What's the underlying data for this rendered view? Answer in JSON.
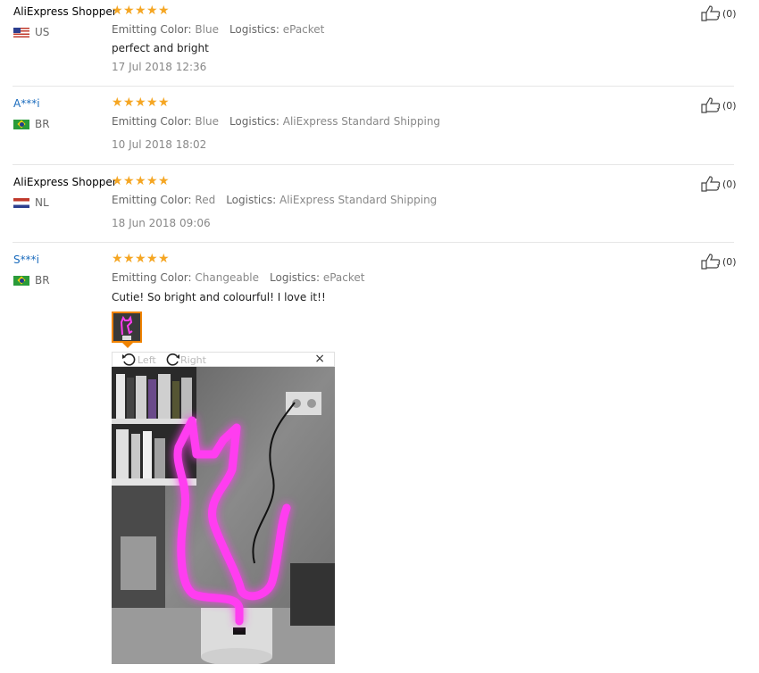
{
  "reviews": [
    {
      "user": "AliExpress Shopper",
      "country": "US",
      "stars": 5,
      "color_label": "Emitting Color:",
      "color_value": "Blue",
      "logistics_label": "Logistics:",
      "logistics_value": "ePacket",
      "text": "perfect and bright",
      "date": "17 Jul 2018 12:36",
      "likes": "(0)"
    },
    {
      "user": "A***i",
      "country": "BR",
      "stars": 5,
      "color_label": "Emitting Color:",
      "color_value": "Blue",
      "logistics_label": "Logistics:",
      "logistics_value": "AliExpress Standard Shipping",
      "date": "10 Jul 2018 18:02",
      "likes": "(0)"
    },
    {
      "user": "AliExpress Shopper",
      "country": "NL",
      "stars": 5,
      "color_label": "Emitting Color:",
      "color_value": "Red",
      "logistics_label": "Logistics:",
      "logistics_value": "AliExpress Standard Shipping",
      "date": "18 Jun 2018 09:06",
      "likes": "(0)"
    },
    {
      "user": "S***i",
      "country": "BR",
      "stars": 5,
      "color_label": "Emitting Color:",
      "color_value": "Changeable",
      "logistics_label": "Logistics:",
      "logistics_value": "ePacket",
      "text": "Cutie! So bright and colourful! I love it!!",
      "likes": "(0)"
    }
  ],
  "viewer": {
    "rotate_left": "Left",
    "rotate_right": "Right",
    "close": "×"
  },
  "colors": {
    "star": "#f5a623",
    "anon_user": "#1a6bbd",
    "thumb_border": "#f08300",
    "neon": "#ff3df0"
  },
  "icons": {
    "like": "thumbs-up-icon",
    "rotate_left": "rotate-left-icon",
    "rotate_right": "rotate-right-icon",
    "close": "close-icon"
  }
}
